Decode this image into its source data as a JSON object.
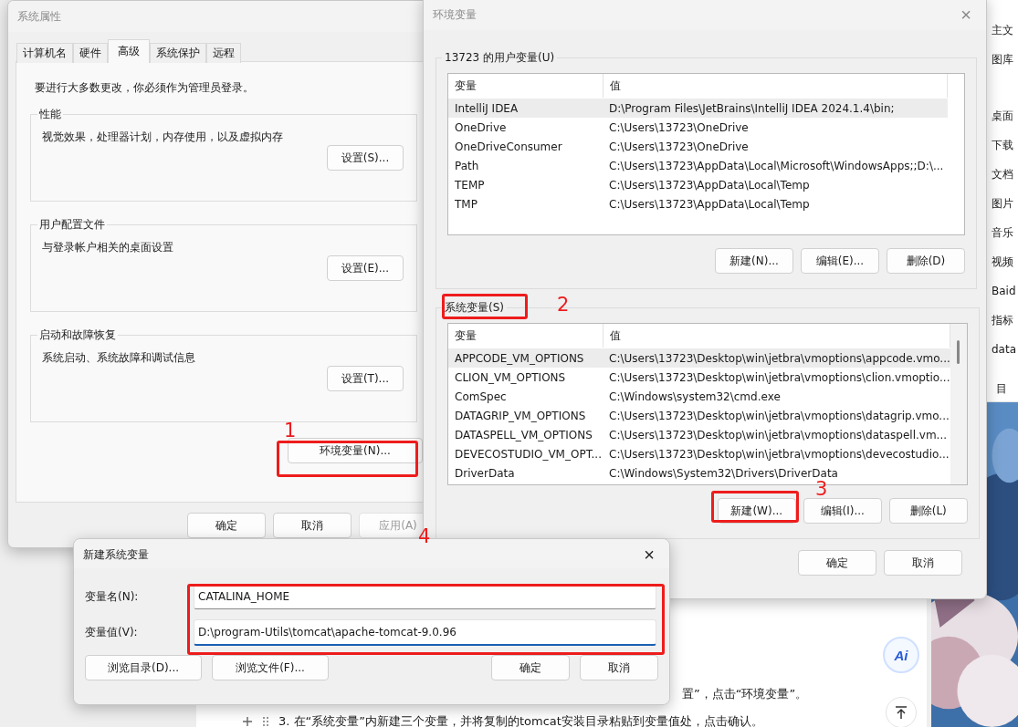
{
  "system_properties": {
    "title": "系统属性",
    "tabs": [
      {
        "label": "计算机名",
        "selected": false
      },
      {
        "label": "硬件",
        "selected": false
      },
      {
        "label": "高级",
        "selected": true
      },
      {
        "label": "系统保护",
        "selected": false
      },
      {
        "label": "远程",
        "selected": false
      }
    ],
    "notice": "要进行大多数更改，你必须作为管理员登录。",
    "groups": [
      {
        "title": "性能",
        "description": "视觉效果，处理器计划，内存使用，以及虚拟内存",
        "button": "设置(S)..."
      },
      {
        "title": "用户配置文件",
        "description": "与登录帐户相关的桌面设置",
        "button": "设置(E)..."
      },
      {
        "title": "启动和故障恢复",
        "description": "系统启动、系统故障和调试信息",
        "button": "设置(T)..."
      }
    ],
    "env_button": "环境变量(N)...",
    "buttons": [
      {
        "label": "确定",
        "disabled": false
      },
      {
        "label": "取消",
        "disabled": false
      },
      {
        "label": "应用(A)",
        "disabled": true
      }
    ]
  },
  "environment_variables": {
    "title": "环境变量",
    "close": "×",
    "sections": [
      {
        "title": "13723 的用户变量(U)",
        "columns": [
          "变量",
          "值"
        ],
        "rows": [
          {
            "name": "IntelliJ IDEA",
            "value": "D:\\Program Files\\JetBrains\\IntelliJ IDEA 2024.1.4\\bin;",
            "selected": true
          },
          {
            "name": "OneDrive",
            "value": "C:\\Users\\13723\\OneDrive",
            "selected": false
          },
          {
            "name": "OneDriveConsumer",
            "value": "C:\\Users\\13723\\OneDrive",
            "selected": false
          },
          {
            "name": "Path",
            "value": "C:\\Users\\13723\\AppData\\Local\\Microsoft\\WindowsApps;;D:\\...",
            "selected": false
          },
          {
            "name": "TEMP",
            "value": "C:\\Users\\13723\\AppData\\Local\\Temp",
            "selected": false
          },
          {
            "name": "TMP",
            "value": "C:\\Users\\13723\\AppData\\Local\\Temp",
            "selected": false
          }
        ],
        "buttons": [
          "新建(N)...",
          "编辑(E)...",
          "删除(D)"
        ]
      },
      {
        "title": "系统变量(S)",
        "columns": [
          "变量",
          "值"
        ],
        "rows": [
          {
            "name": "APPCODE_VM_OPTIONS",
            "value": "C:\\Users\\13723\\Desktop\\win\\jetbra\\vmoptions\\appcode.vmo...",
            "selected": true
          },
          {
            "name": "CLION_VM_OPTIONS",
            "value": "C:\\Users\\13723\\Desktop\\win\\jetbra\\vmoptions\\clion.vmoptio...",
            "selected": false
          },
          {
            "name": "ComSpec",
            "value": "C:\\Windows\\system32\\cmd.exe",
            "selected": false
          },
          {
            "name": "DATAGRIP_VM_OPTIONS",
            "value": "C:\\Users\\13723\\Desktop\\win\\jetbra\\vmoptions\\datagrip.vmo...",
            "selected": false
          },
          {
            "name": "DATASPELL_VM_OPTIONS",
            "value": "C:\\Users\\13723\\Desktop\\win\\jetbra\\vmoptions\\dataspell.vm...",
            "selected": false
          },
          {
            "name": "DEVECOSTUDIO_VM_OPT...",
            "value": "C:\\Users\\13723\\Desktop\\win\\jetbra\\vmoptions\\devecostudio...",
            "selected": false
          },
          {
            "name": "DriverData",
            "value": "C:\\Windows\\System32\\Drivers\\DriverData",
            "selected": false
          }
        ],
        "buttons": [
          "新建(W)...",
          "编辑(I)...",
          "删除(L)"
        ]
      }
    ],
    "buttons": [
      "确定",
      "取消"
    ]
  },
  "new_system_variable": {
    "title": "新建系统变量",
    "close": "×",
    "fields": [
      {
        "label": "变量名(N):",
        "value": "CATALINA_HOME",
        "focused": false
      },
      {
        "label": "变量值(V):",
        "value": "D:\\program-Utils\\tomcat\\apache-tomcat-9.0.96",
        "focused": true
      }
    ],
    "buttons": [
      "浏览目录(D)...",
      "浏览文件(F)...",
      "确定",
      "取消"
    ]
  },
  "explorer_sidebar": {
    "items": [
      "主文",
      "图库",
      "桌面",
      "下载",
      "文档",
      "图片",
      "音乐",
      "视频",
      "Baid",
      "指标",
      "data"
    ],
    "status": "目"
  },
  "document": {
    "lines": [
      "置”，点击“环境变量”。",
      "3. 在“系统变量”内新建三个变量，并将复制的tomcat安装目录粘贴到变量值处，点击确认。"
    ],
    "ai_button": "Ai"
  },
  "annotations": [
    "1",
    "2",
    "3",
    "4"
  ]
}
